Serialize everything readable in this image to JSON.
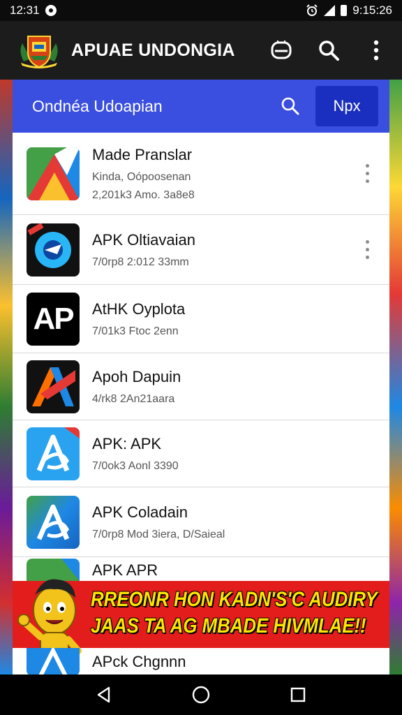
{
  "status_bar": {
    "time": "12:31",
    "right_time": "9:15:26"
  },
  "app_bar": {
    "title": "APUAE UNDONGIA"
  },
  "search_header": {
    "title": "Ondnéa Udoapian",
    "button_label": "Npx"
  },
  "items": [
    {
      "name": "Made Pranslar",
      "meta": "Kinda, Oópoosenan",
      "meta2": "2,201k3 Amo. 3a8e8"
    },
    {
      "name": "APK Oltiavaian",
      "meta": "7/0rp8 2:012 33mm"
    },
    {
      "name": "AtHK Oyplota",
      "meta": "7/01k3 Ftoc 2enn",
      "thumb_label": "AP"
    },
    {
      "name": "Apoh Dapuin",
      "meta": "4/rk8 2An21aara"
    },
    {
      "name": "APK: APK",
      "meta": "7/0ok3 Aonl 3390"
    },
    {
      "name": "APK Coladain",
      "meta": "7/0rp8 Mod 3iera, D/Saieal"
    }
  ],
  "partial_item": {
    "name": "APK APR"
  },
  "last_item": {
    "name": "APck Chgnnn"
  },
  "ad_banner": {
    "line1": "RREONR HON KADN'S'C AUDIRY",
    "line2": "JAAS TA AG MBADE HIVMLAE!!"
  },
  "colors": {
    "header_blue": "#3a4fe0",
    "button_blue": "#1a2fbf",
    "ad_red": "#e31c1c",
    "ad_yellow": "#ffe600"
  }
}
